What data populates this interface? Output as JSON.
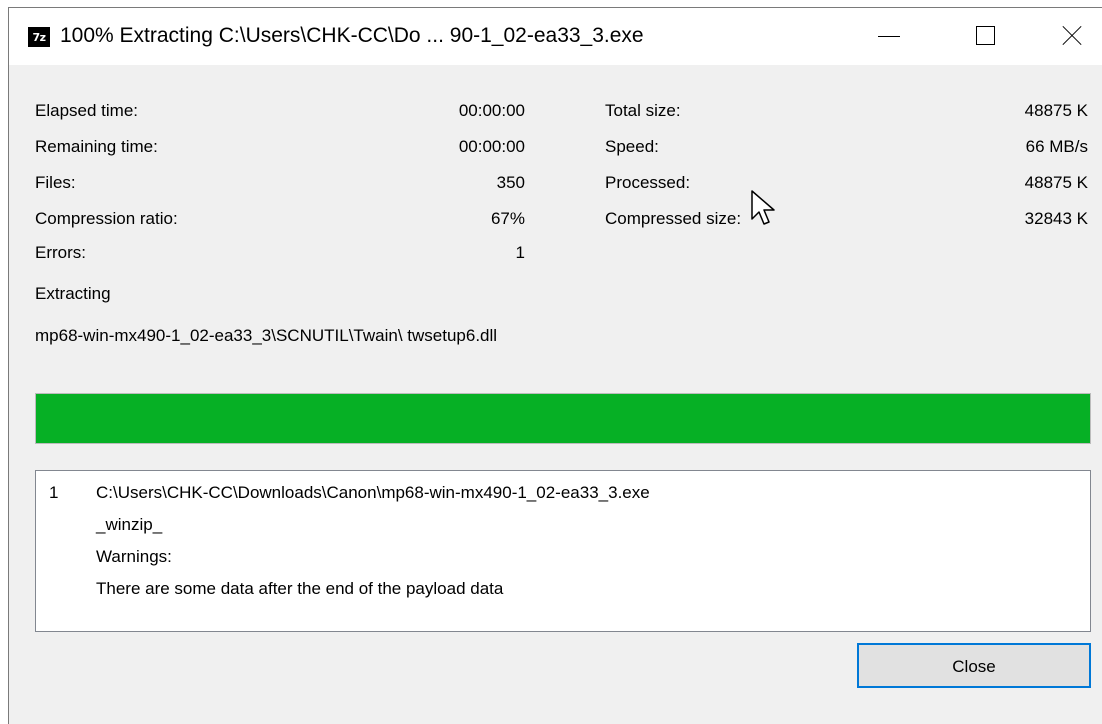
{
  "window": {
    "title": "100% Extracting C:\\Users\\CHK-CC\\Do ... 90-1_02-ea33_3.exe",
    "app_icon": "7z"
  },
  "stats": {
    "elapsed_label": "Elapsed time:",
    "elapsed_value": "00:00:00",
    "remaining_label": "Remaining time:",
    "remaining_value": "00:00:00",
    "files_label": "Files:",
    "files_value": "350",
    "ratio_label": "Compression ratio:",
    "ratio_value": "67%",
    "errors_label": "Errors:",
    "errors_value": "1",
    "total_size_label": "Total size:",
    "total_size_value": "48875 K",
    "speed_label": "Speed:",
    "speed_value": "66 MB/s",
    "processed_label": "Processed:",
    "processed_value": "48875 K",
    "compressed_label": "Compressed size:",
    "compressed_value": "32843 K"
  },
  "current": {
    "label": "Extracting",
    "path": "mp68-win-mx490-1_02-ea33_3\\SCNUTIL\\Twain\\ twsetup6.dll"
  },
  "progress": {
    "percent": 100,
    "color": "#06b025"
  },
  "log": {
    "number": "1",
    "lines": [
      "C:\\Users\\CHK-CC\\Downloads\\Canon\\mp68-win-mx490-1_02-ea33_3.exe",
      "_winzip_",
      "Warnings:",
      "There are some data after the end of the payload data"
    ]
  },
  "buttons": {
    "close_label": "Close"
  }
}
